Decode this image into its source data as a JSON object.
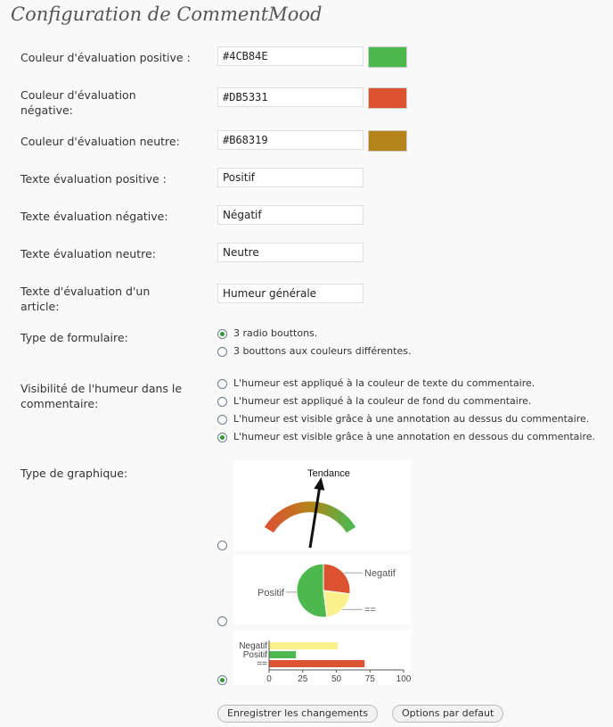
{
  "page": {
    "title": "Configuration de CommentMood"
  },
  "fields": {
    "positive_color_label": "Couleur d'évaluation positive :",
    "positive_color_value": "#4CB84E",
    "positive_color_swatch": "#4CB84E",
    "negative_color_label": "Couleur d'évaluation négative:",
    "negative_color_value": "#DB5331",
    "negative_color_swatch": "#DB5331",
    "neutral_color_label": "Couleur d'évaluation neutre:",
    "neutral_color_value": "#B68319",
    "neutral_color_swatch": "#B68319",
    "positive_text_label": "Texte évaluation positive :",
    "positive_text_value": "Positif",
    "negative_text_label": "Texte évaluation négative:",
    "negative_text_value": "Négatif",
    "neutral_text_label": "Texte évaluation neutre:",
    "neutral_text_value": "Neutre",
    "article_text_label": "Texte d'évaluation d'un article:",
    "article_text_value": "Humeur générale"
  },
  "form_type": {
    "label": "Type de formulaire:",
    "options": [
      "3 radio bouttons.",
      "3 bouttons aux couleurs différentes."
    ],
    "selected": 0
  },
  "visibility": {
    "label": "Visibilité de l'humeur dans le commentaire:",
    "options": [
      "L'humeur est appliqué à la couleur de texte du commentaire.",
      "L'humeur est appliqué à la couleur de fond du commentaire.",
      "L'humeur est visible grâce à une annotation au dessus du commentaire.",
      "L'humeur est visible grâce à une annotation en dessous du commentaire."
    ],
    "selected": 3
  },
  "chart_type": {
    "label": "Type de graphique:",
    "selected": 2,
    "gauge": {
      "title": "Tendance",
      "colors": [
        "#DB5331",
        "#B68319",
        "#4CB84E"
      ],
      "needle_value": 0.6
    },
    "pie": {
      "labels": [
        "Negatif",
        "==",
        "Positif"
      ],
      "values": [
        27,
        21,
        52
      ],
      "colors": [
        "#DB5331",
        "#FAF08C",
        "#4CB84E"
      ]
    }
  },
  "chart_data": {
    "type": "bar",
    "orientation": "horizontal",
    "categories": [
      "Negatif",
      "Positif",
      "=="
    ],
    "values": [
      51,
      20,
      71
    ],
    "colors": [
      "#FAF08C",
      "#4CB84E",
      "#DB5331"
    ],
    "xticks": [
      "0",
      "25",
      "50",
      "75",
      "100"
    ],
    "xlim": [
      0,
      100
    ],
    "grid": false
  },
  "buttons": {
    "save": "Enregistrer les changements",
    "defaults": "Options par defaut"
  }
}
